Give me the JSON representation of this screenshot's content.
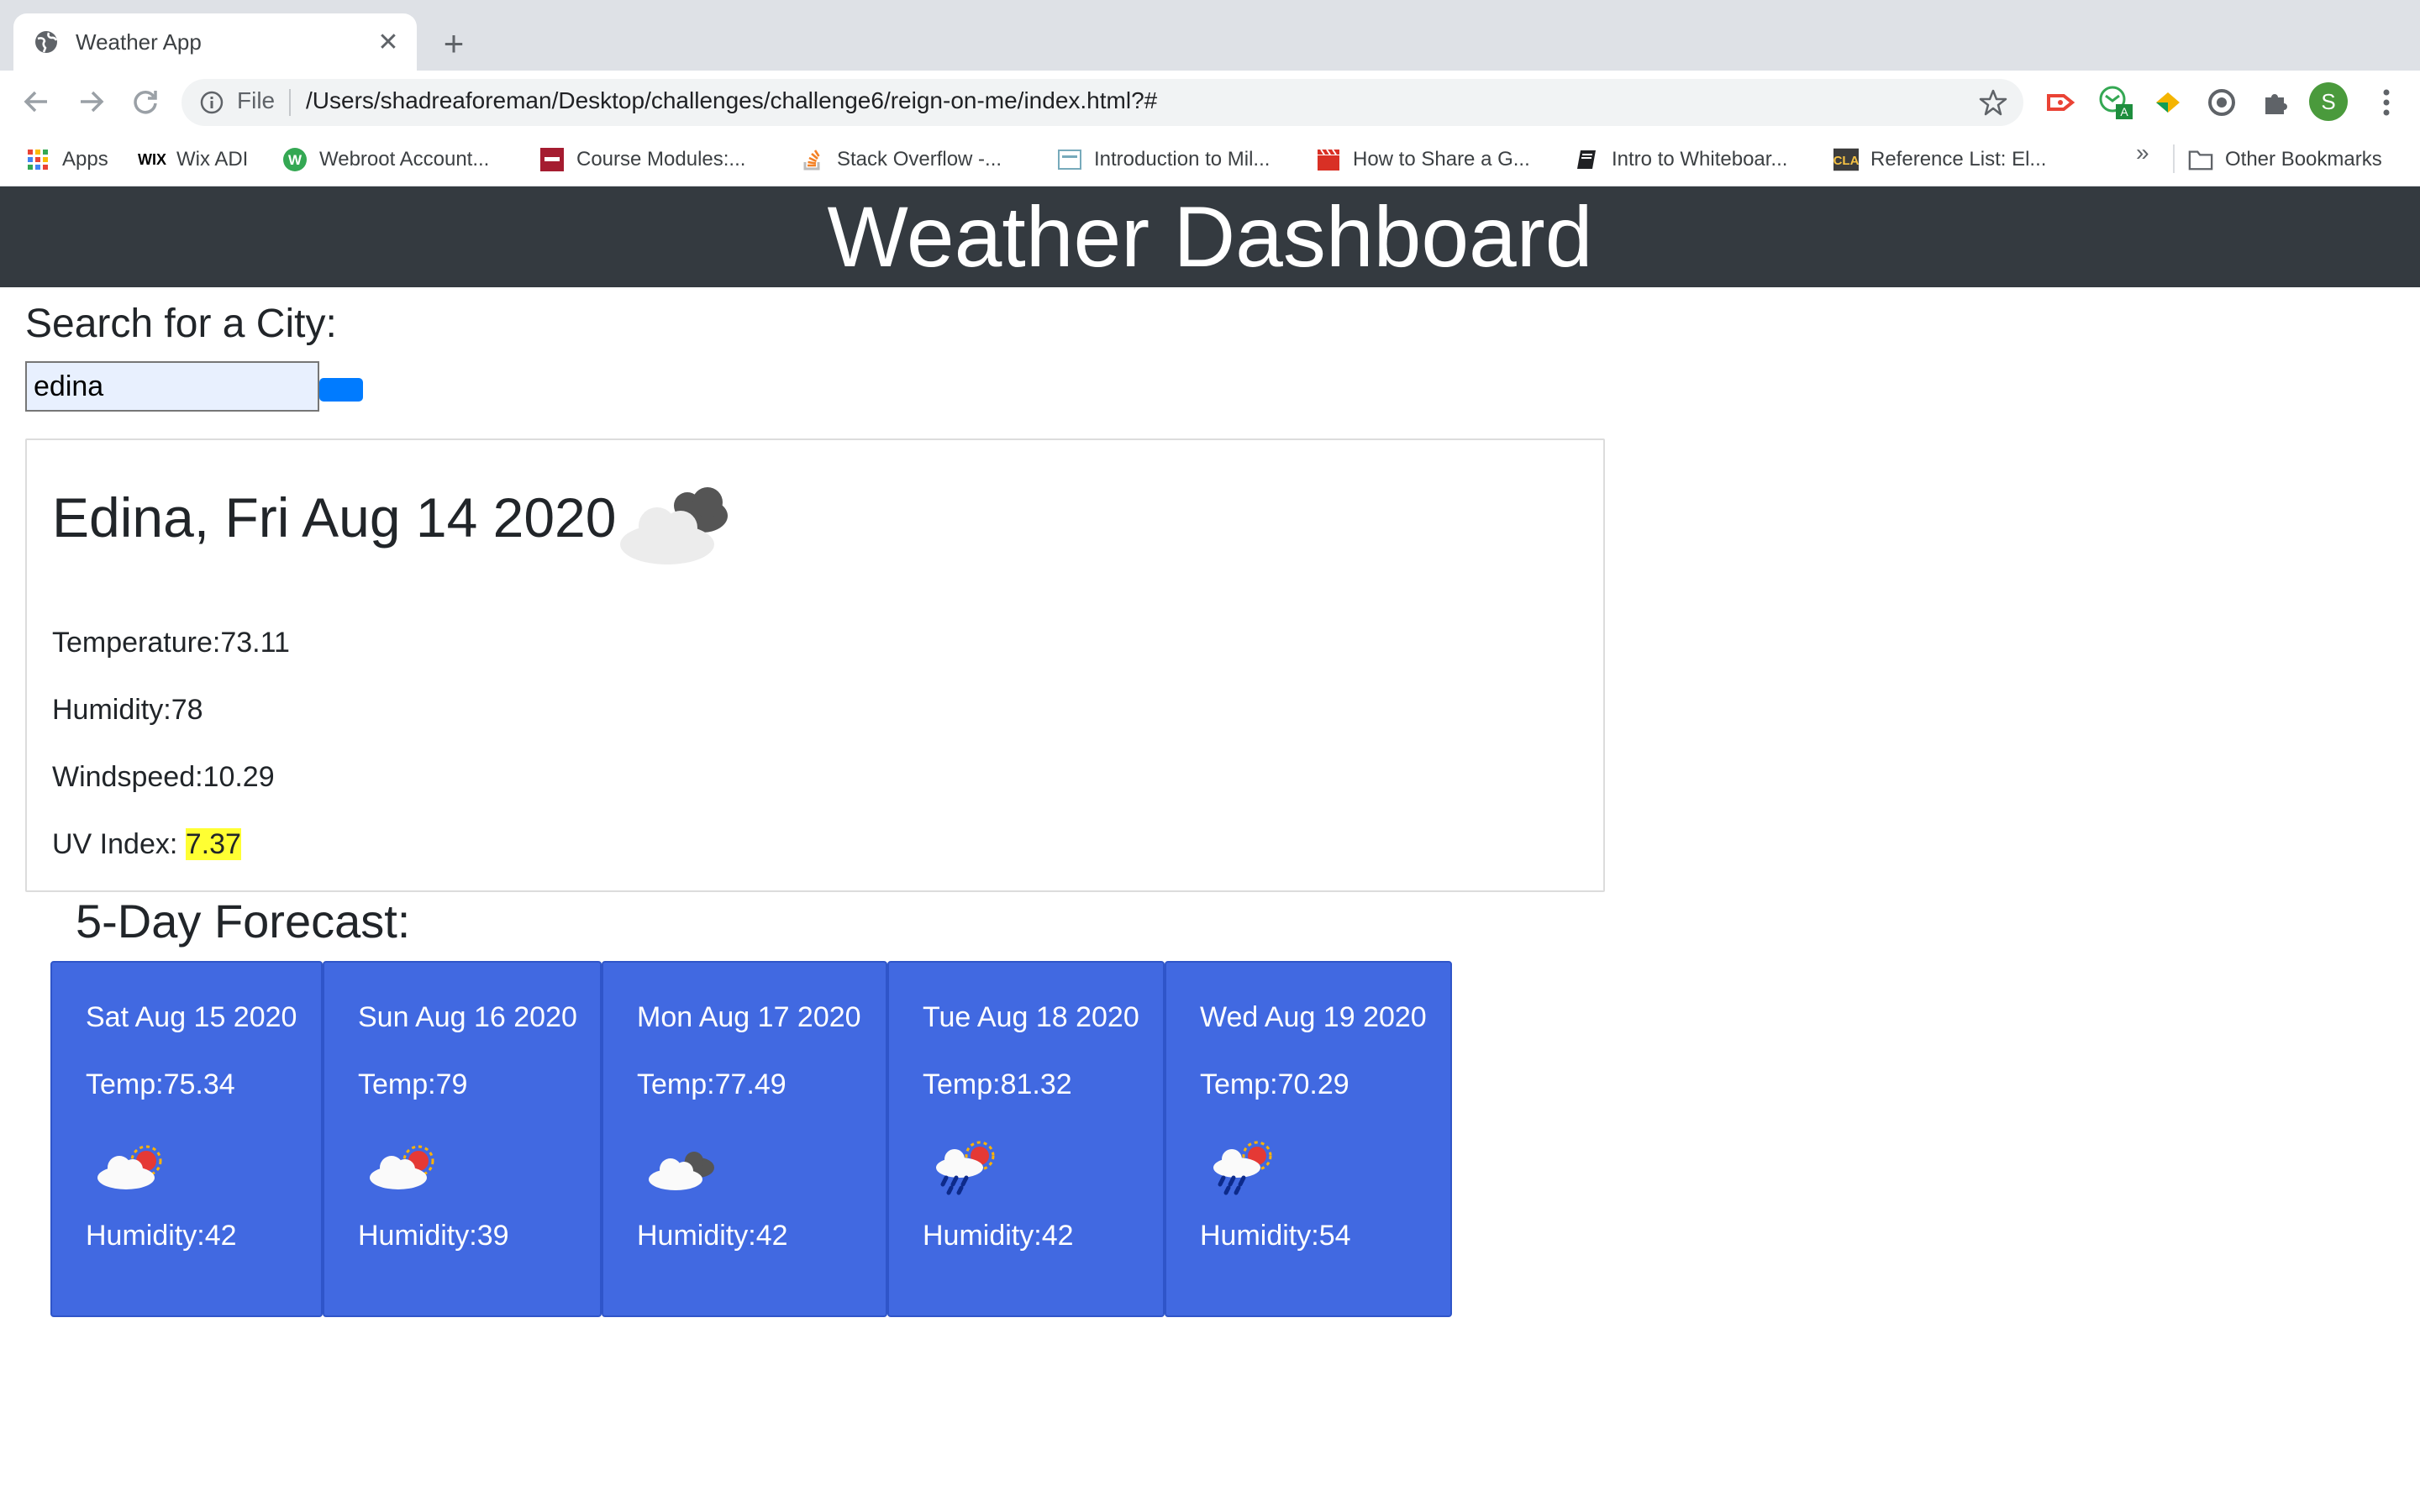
{
  "browser": {
    "tab_title": "Weather App",
    "new_tab_glyph": "+",
    "close_glyph": "✕",
    "omnibox": {
      "scheme_label": "File",
      "url": "/Users/shadreaforeman/Desktop/challenges/challenge6/reign-on-me/index.html?#"
    },
    "profile_initial": "S",
    "bookmarks": [
      {
        "label": "Apps",
        "icon": "apps-grid-icon"
      },
      {
        "label": "Wix ADI",
        "icon": "wix-icon"
      },
      {
        "label": "Webroot Account...",
        "icon": "webroot-icon"
      },
      {
        "label": "Course Modules:...",
        "icon": "course-icon"
      },
      {
        "label": "Stack Overflow -...",
        "icon": "stackoverflow-icon"
      },
      {
        "label": "Introduction to Mil...",
        "icon": "career-icon"
      },
      {
        "label": "How to Share a G...",
        "icon": "clapper-icon"
      },
      {
        "label": "Intro to Whiteboar...",
        "icon": "book-icon"
      },
      {
        "label": "Reference List: El...",
        "icon": "cla-icon"
      }
    ],
    "bookmarks_overflow": "»",
    "other_bookmarks": "Other Bookmarks"
  },
  "page": {
    "header_title": "Weather Dashboard",
    "search": {
      "label": "Search for a City:",
      "value": "edina"
    },
    "today": {
      "title": "Edina, Fri Aug 14 2020",
      "temperature": "Temperature:73.11",
      "humidity": "Humidity:78",
      "windspeed": "Windspeed:10.29",
      "uv_label": "UV Index: ",
      "uv_value": "7.37",
      "uv_color": "#ffff33",
      "icon": "broken-clouds-icon"
    },
    "forecast_title": "5-Day Forecast:",
    "forecast": [
      {
        "date": "Sat Aug 15 2020",
        "temp": "Temp:75.34",
        "humidity": "Humidity:42",
        "icon": "few-clouds-icon"
      },
      {
        "date": "Sun Aug 16 2020",
        "temp": "Temp:79",
        "humidity": "Humidity:39",
        "icon": "few-clouds-icon"
      },
      {
        "date": "Mon Aug 17 2020",
        "temp": "Temp:77.49",
        "humidity": "Humidity:42",
        "icon": "broken-clouds-icon"
      },
      {
        "date": "Tue Aug 18 2020",
        "temp": "Temp:81.32",
        "humidity": "Humidity:42",
        "icon": "rain-icon"
      },
      {
        "date": "Wed Aug 19 2020",
        "temp": "Temp:70.29",
        "humidity": "Humidity:54",
        "icon": "rain-icon"
      }
    ],
    "colors": {
      "header_bg": "#343a40",
      "card_bg": "#4169e1",
      "search_button": "#007bff"
    }
  }
}
